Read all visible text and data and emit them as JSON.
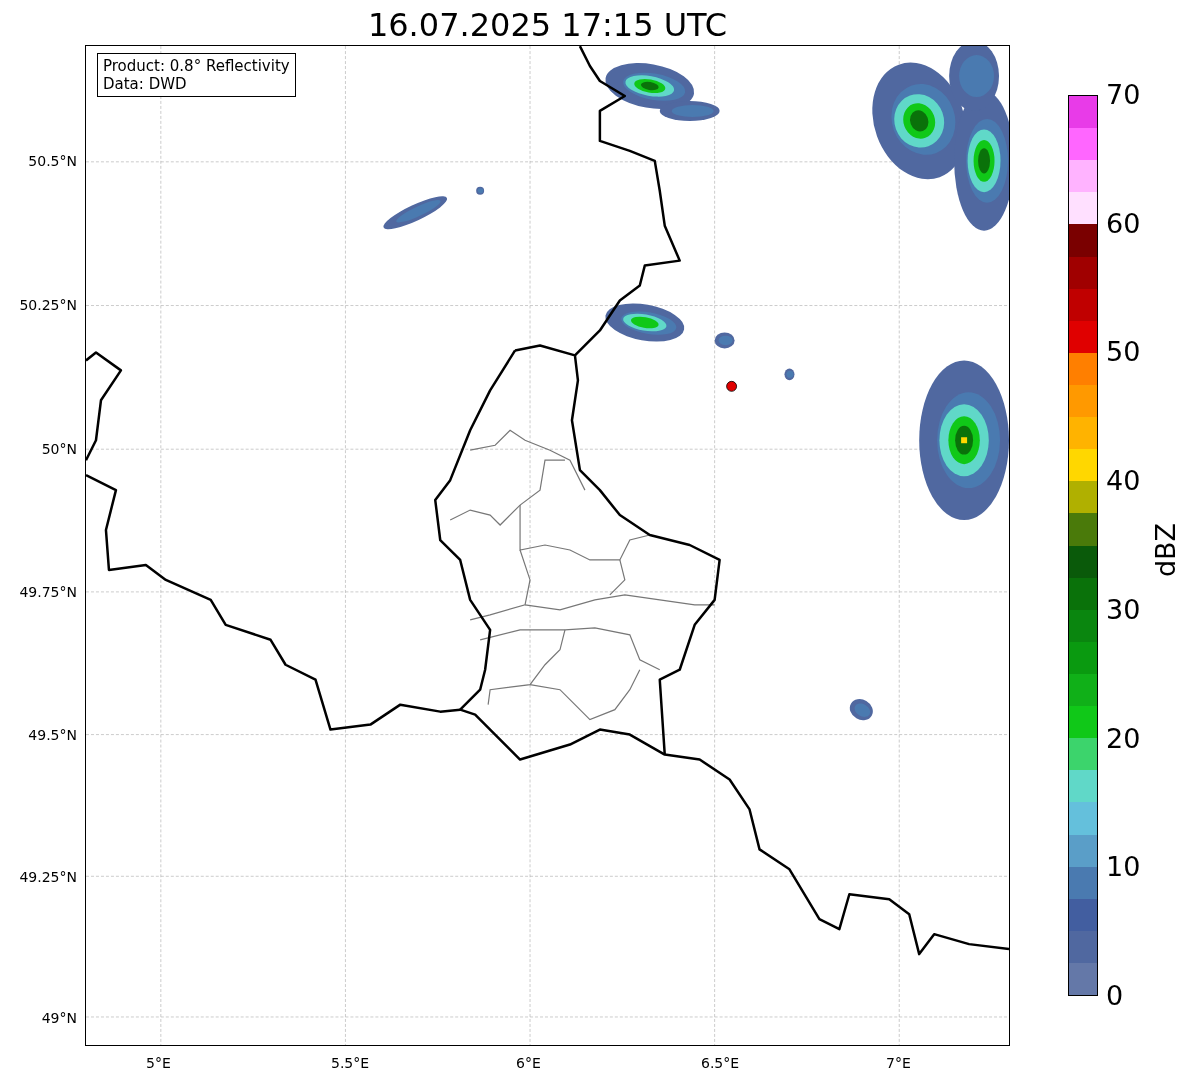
{
  "title": "16.07.2025 17:15 UTC",
  "annotation": [
    "Product: 0.8° Reflectivity",
    "Data: DWD"
  ],
  "y_ticks": [
    "50.5°N",
    "50.25°N",
    "50°N",
    "49.75°N",
    "49.5°N",
    "49.25°N",
    "49°N"
  ],
  "x_ticks": [
    "5°E",
    "5.5°E",
    "6°E",
    "6.5°E",
    "7°E"
  ],
  "colorbar": {
    "label": "dBZ",
    "ticks": [
      "70",
      "60",
      "50",
      "40",
      "30",
      "20",
      "10",
      "0"
    ],
    "bands": [
      {
        "color": "#e83be8"
      },
      {
        "color": "#ff66ff"
      },
      {
        "color": "#ffb3ff"
      },
      {
        "color": "#ffe0ff"
      },
      {
        "color": "#7a0000"
      },
      {
        "color": "#a00000"
      },
      {
        "color": "#c00000"
      },
      {
        "color": "#e00000"
      },
      {
        "color": "#ff7f00"
      },
      {
        "color": "#ff9900"
      },
      {
        "color": "#ffb300"
      },
      {
        "color": "#ffd700"
      },
      {
        "color": "#b0b000"
      },
      {
        "color": "#4a7a0a"
      },
      {
        "color": "#0a5a0a"
      },
      {
        "color": "#0a720a"
      },
      {
        "color": "#0a860f"
      },
      {
        "color": "#0a9a10"
      },
      {
        "color": "#10b018"
      },
      {
        "color": "#10c818"
      },
      {
        "color": "#3cd46c"
      },
      {
        "color": "#60d8c8"
      },
      {
        "color": "#64c0dc"
      },
      {
        "color": "#5a9ec8"
      },
      {
        "color": "#4a7ab0"
      },
      {
        "color": "#425ea0"
      },
      {
        "color": "#5068a0"
      },
      {
        "color": "#6478a8"
      }
    ]
  }
}
